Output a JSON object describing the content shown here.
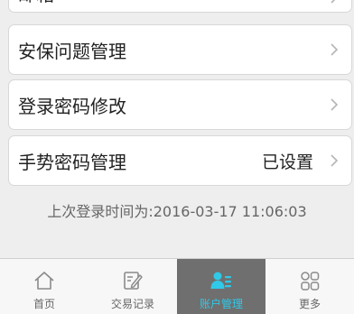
{
  "settings": {
    "items": [
      {
        "label": "邮箱",
        "value": ""
      },
      {
        "label": "安保问题管理",
        "value": ""
      },
      {
        "label": "登录密码修改",
        "value": ""
      },
      {
        "label": "手势密码管理",
        "value": "已设置"
      }
    ],
    "last_login": "上次登录时间为:2016-03-17 11:06:03"
  },
  "tabbar": {
    "tabs": [
      {
        "label": "首页",
        "icon": "home-icon",
        "active": false
      },
      {
        "label": "交易记录",
        "icon": "edit-document-icon",
        "active": false
      },
      {
        "label": "账户管理",
        "icon": "user-manage-icon",
        "active": true
      },
      {
        "label": "更多",
        "icon": "more-grid-icon",
        "active": false
      }
    ]
  },
  "colors": {
    "active_accent": "#30c9e8",
    "active_tab_bg": "#6f6f6f",
    "background": "#eeeeee"
  }
}
